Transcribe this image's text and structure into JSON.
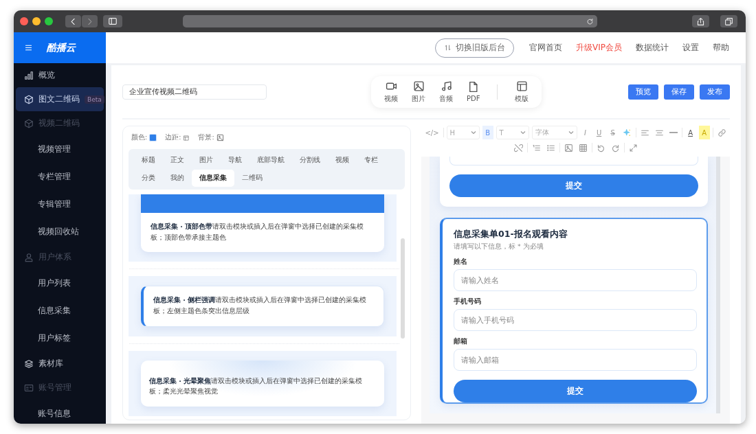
{
  "brand": {
    "name": "酷播云"
  },
  "sidebar": {
    "items": [
      {
        "kind": "item",
        "label": "概览",
        "selected": false
      },
      {
        "kind": "item",
        "label": "图文二维码",
        "selected": true,
        "badge": "Beta"
      },
      {
        "kind": "group",
        "label": "视频二维码",
        "selected": false
      },
      {
        "kind": "sub",
        "label": "视频管理",
        "selected": false
      },
      {
        "kind": "sub",
        "label": "专栏管理",
        "selected": false
      },
      {
        "kind": "sub",
        "label": "专辑管理",
        "selected": false
      },
      {
        "kind": "sub",
        "label": "视频回收站",
        "selected": false
      },
      {
        "kind": "group",
        "label": "用户体系",
        "selected": false
      },
      {
        "kind": "sub",
        "label": "用户列表",
        "selected": false
      },
      {
        "kind": "sub",
        "label": "信息采集",
        "selected": false
      },
      {
        "kind": "sub",
        "label": "用户标签",
        "selected": false
      },
      {
        "kind": "item",
        "label": "素材库",
        "selected": false
      },
      {
        "kind": "group",
        "label": "账号管理",
        "selected": false
      },
      {
        "kind": "sub",
        "label": "账号信息",
        "selected": false
      }
    ]
  },
  "header": {
    "links": [
      {
        "kind": "switch",
        "label": "切换旧版后台"
      },
      {
        "kind": "link",
        "label": "官网首页"
      },
      {
        "kind": "promo",
        "label": "升级VIP会员"
      },
      {
        "kind": "link",
        "label": "数据统计"
      },
      {
        "kind": "link",
        "label": "设置"
      },
      {
        "kind": "link",
        "label": "帮助"
      }
    ]
  },
  "editor": {
    "title_value": "企业宣传视频二维码",
    "media_toolbar": [
      {
        "kind": "video",
        "label": "视频"
      },
      {
        "kind": "image",
        "label": "图片"
      },
      {
        "kind": "audio",
        "label": "音频"
      },
      {
        "kind": "pdf",
        "label": "PDF"
      },
      {
        "kind": "sep"
      },
      {
        "kind": "template",
        "label": "模版"
      }
    ],
    "actions": [
      "预览",
      "保存",
      "发布"
    ]
  },
  "left_panel": {
    "options": [
      "颜色:",
      "边距:",
      "背景:"
    ],
    "tabs": [
      {
        "label": "标题",
        "selected": false
      },
      {
        "label": "正文",
        "selected": false
      },
      {
        "label": "图片",
        "selected": false
      },
      {
        "label": "导航",
        "selected": false
      },
      {
        "label": "底部导航",
        "selected": false
      },
      {
        "label": "分割线",
        "selected": false
      },
      {
        "label": "视频",
        "selected": false
      },
      {
        "label": "专栏",
        "selected": false
      },
      {
        "label": "分类",
        "selected": false
      },
      {
        "label": "我的",
        "selected": false
      },
      {
        "label": "信息采集",
        "selected": true
      },
      {
        "label": "二维码",
        "selected": false
      }
    ],
    "templates": [
      {
        "kind": "topband",
        "text": "**信息采集 · 顶部色带**请双击模块或插入后在弹窗中选择已创建的采集模板；顶部色带承接主题色"
      },
      {
        "kind": "sidebar",
        "text": "**信息采集 · 侧栏强调**请双击模块或插入后在弹窗中选择已创建的采集模板；左侧主题色条突出信息层级"
      },
      {
        "kind": "glow",
        "text": "**信息采集 · 光晕聚焦**请双击模块或插入后在弹窗中选择已创建的采集模板；柔光光晕聚焦视觉"
      }
    ]
  },
  "editor_toolbar": {
    "rows": [
      [
        {
          "kind": "code",
          "label": "</>"
        },
        {
          "kind": "sep"
        },
        {
          "kind": "select",
          "label": "H"
        },
        {
          "kind": "toggle",
          "label": "B",
          "on": true
        },
        {
          "kind": "select",
          "label": "T"
        },
        {
          "kind": "select",
          "label": "字体"
        },
        {
          "kind": "italic",
          "label": "I"
        },
        {
          "kind": "underline",
          "label": "U"
        },
        {
          "kind": "strike",
          "label": "S"
        },
        {
          "kind": "sparkle"
        },
        {
          "kind": "sep"
        },
        {
          "kind": "alignleft"
        },
        {
          "kind": "aligncenter"
        },
        {
          "kind": "rule"
        },
        {
          "kind": "sep"
        },
        {
          "kind": "fontcolor",
          "label": "A"
        },
        {
          "kind": "highlight",
          "label": "A"
        },
        {
          "kind": "sep"
        },
        {
          "kind": "link"
        }
      ],
      [
        {
          "kind": "unlink"
        },
        {
          "kind": "sep"
        },
        {
          "kind": "olist"
        },
        {
          "kind": "ulist"
        },
        {
          "kind": "sep"
        },
        {
          "kind": "image"
        },
        {
          "kind": "table"
        },
        {
          "kind": "sep"
        },
        {
          "kind": "undo"
        },
        {
          "kind": "redo"
        },
        {
          "kind": "sep"
        },
        {
          "kind": "fullscreen"
        }
      ]
    ]
  },
  "preview": {
    "cards": [
      {
        "selected": false,
        "cut_field": true,
        "button": "提交"
      },
      {
        "selected": true,
        "title": "信息采集单01-报名观看内容",
        "subtitle": "请填写以下信息，标 * 为必填",
        "fields": [
          {
            "label": "姓名",
            "placeholder": "请输入姓名"
          },
          {
            "label": "手机号码",
            "placeholder": "请输入手机号码"
          },
          {
            "label": "邮箱",
            "placeholder": "请输入邮箱"
          }
        ],
        "button": "提交"
      }
    ]
  }
}
